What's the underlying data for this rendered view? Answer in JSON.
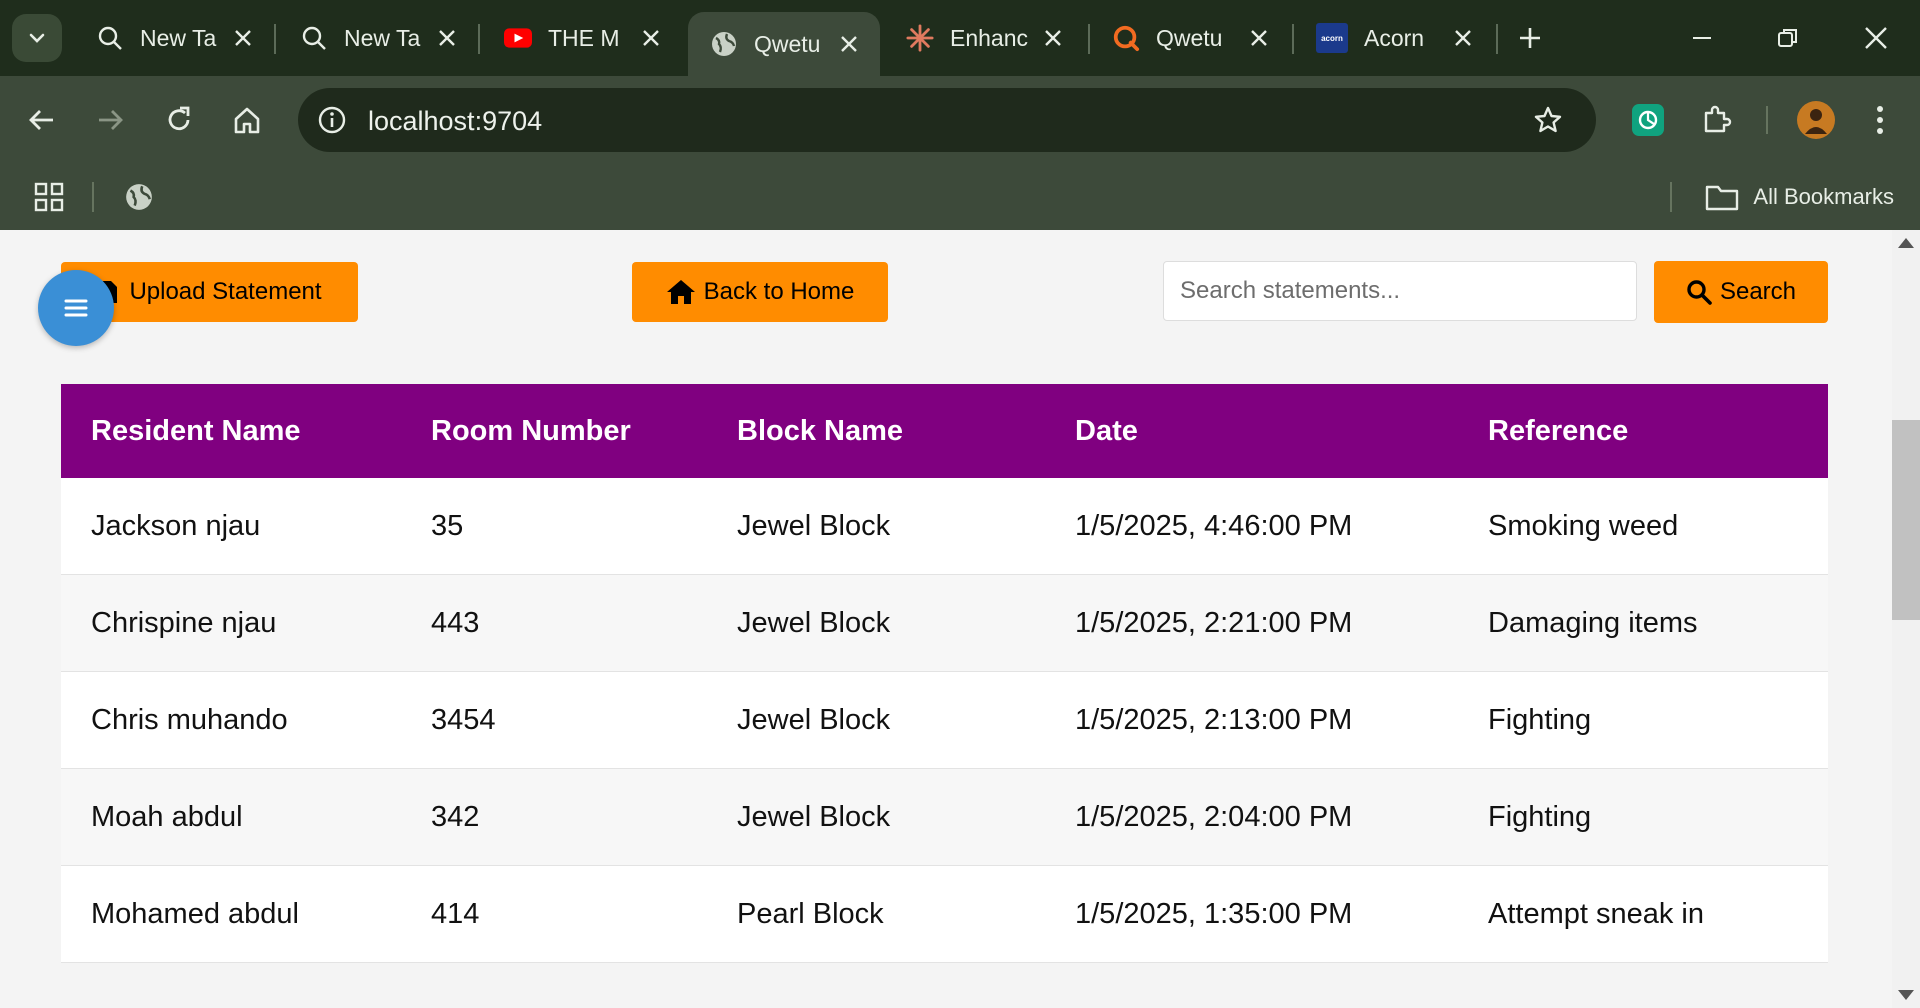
{
  "browser": {
    "tabs": [
      {
        "label": "New Ta",
        "icon": "search-icon"
      },
      {
        "label": "New Ta",
        "icon": "search-icon"
      },
      {
        "label": "THE M",
        "icon": "youtube-icon"
      },
      {
        "label": "Qwetu",
        "icon": "globe-icon",
        "active": true
      },
      {
        "label": "Enhanc",
        "icon": "claude-icon"
      },
      {
        "label": "Qwetu",
        "icon": "qwetu-icon"
      },
      {
        "label": "Acorn",
        "icon": "acorn-icon",
        "icon_text": "acorn"
      }
    ],
    "url": "localhost:9704",
    "bookmarks_label": "All Bookmarks"
  },
  "page": {
    "upload_label": "Upload Statement",
    "home_label": "Back to Home",
    "search_placeholder": "Search statements...",
    "search_label": "Search",
    "colors": {
      "accent": "#ff8c00",
      "header": "#800080",
      "fab": "#3a8fd6"
    }
  },
  "table": {
    "headers": [
      "Resident Name",
      "Room Number",
      "Block Name",
      "Date",
      "Reference"
    ],
    "rows": [
      [
        "Jackson njau",
        "35",
        "Jewel Block",
        "1/5/2025, 4:46:00 PM",
        "Smoking weed"
      ],
      [
        "Chrispine njau",
        "443",
        "Jewel Block",
        "1/5/2025, 2:21:00 PM",
        "Damaging items"
      ],
      [
        "Chris muhando",
        "3454",
        "Jewel Block",
        "1/5/2025, 2:13:00 PM",
        "Fighting"
      ],
      [
        "Moah abdul",
        "342",
        "Jewel Block",
        "1/5/2025, 2:04:00 PM",
        "Fighting"
      ],
      [
        "Mohamed abdul",
        "414",
        "Pearl Block",
        "1/5/2025, 1:35:00 PM",
        "Attempt sneak in"
      ]
    ]
  }
}
